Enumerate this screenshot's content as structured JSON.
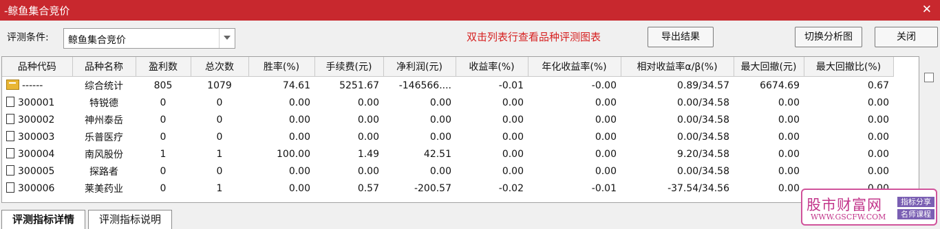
{
  "window": {
    "title": "-鲸鱼集合竞价",
    "close_glyph": "✕"
  },
  "toolbar": {
    "condition_label": "评测条件:",
    "condition_value": "鲸鱼集合竞价",
    "hint": "双击列表行查看品种评测图表",
    "export_label": "导出结果",
    "switch_label": "切换分析图",
    "close_label": "关闭"
  },
  "table": {
    "columns": [
      "品种代码",
      "品种名称",
      "盈利数",
      "总次数",
      "胜率(%)",
      "手续费(元)",
      "净利润(元)",
      "收益率(%)",
      "年化收益率(%)",
      "相对收益率α/β(%)",
      "最大回撤(元)",
      "最大回撤比(%)"
    ],
    "summary": [
      "------",
      "综合统计",
      "805",
      "1079",
      "74.61",
      "5251.67",
      "-146566....",
      "-0.01",
      "-0.00",
      "0.89/34.57",
      "6674.69",
      "0.67"
    ],
    "rows": [
      [
        "300001",
        "特锐德",
        "0",
        "0",
        "0.00",
        "0.00",
        "0.00",
        "0.00",
        "0.00",
        "0.00/34.58",
        "0.00",
        "0.00"
      ],
      [
        "300002",
        "神州泰岳",
        "0",
        "0",
        "0.00",
        "0.00",
        "0.00",
        "0.00",
        "0.00",
        "0.00/34.58",
        "0.00",
        "0.00"
      ],
      [
        "300003",
        "乐普医疗",
        "0",
        "0",
        "0.00",
        "0.00",
        "0.00",
        "0.00",
        "0.00",
        "0.00/34.58",
        "0.00",
        "0.00"
      ],
      [
        "300004",
        "南风股份",
        "1",
        "1",
        "100.00",
        "1.49",
        "42.51",
        "0.00",
        "0.00",
        "9.20/34.58",
        "0.00",
        "0.00"
      ],
      [
        "300005",
        "探路者",
        "0",
        "0",
        "0.00",
        "0.00",
        "0.00",
        "0.00",
        "0.00",
        "0.00/34.58",
        "0.00",
        "0.00"
      ],
      [
        "300006",
        "莱美药业",
        "0",
        "1",
        "0.00",
        "0.57",
        "-200.57",
        "-0.02",
        "-0.01",
        "-37.54/34.56",
        "0.00",
        "0.00"
      ]
    ]
  },
  "tabs": [
    "评测指标详情",
    "评测指标说明"
  ],
  "watermark": {
    "site": "股市财富网",
    "url": "WWW.GSCFW.COM",
    "tag1": "指标分享",
    "tag2": "名师课程"
  }
}
